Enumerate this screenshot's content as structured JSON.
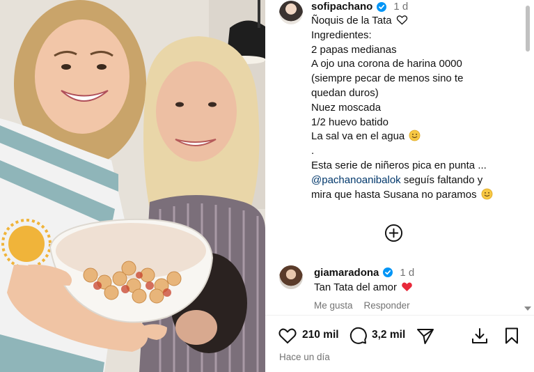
{
  "post": {
    "author": "sofipachano",
    "time": "1 d",
    "caption_lines": [
      "Ñoquis de la Tata",
      "Ingredientes:",
      "2 papas medianas",
      "A ojo una corona de harina 0000",
      "(siempre pecar de menos sino te",
      "quedan duros)",
      "Nuez moscada",
      "1/2 huevo  batido",
      "La sal va en el agua",
      ".",
      "Esta serie de niñeros pica en punta ..."
    ],
    "mention": "@pachanoanibalok",
    "mention_rest": " seguís faltando y",
    "last_line": "mira que hasta Susana no paramos"
  },
  "comment": {
    "author": "giamaradona",
    "time": "1 d",
    "text": "Tan Tata del amor",
    "like_label": "Me gusta",
    "reply_label": "Responder"
  },
  "actions": {
    "likes": "210 mil",
    "comments": "3,2 mil",
    "posted_ago": "Hace un día"
  },
  "colors": {
    "verified": "#0095f6",
    "mention": "#00376b",
    "heart": "#ed4956",
    "muted": "#737373"
  },
  "icons": [
    "heart-icon",
    "comment-icon",
    "share-icon",
    "download-icon",
    "bookmark-icon",
    "plus-circle-icon",
    "verified-badge-icon",
    "smile-emoji",
    "red-heart-emoji",
    "outline-heart-emoji"
  ]
}
